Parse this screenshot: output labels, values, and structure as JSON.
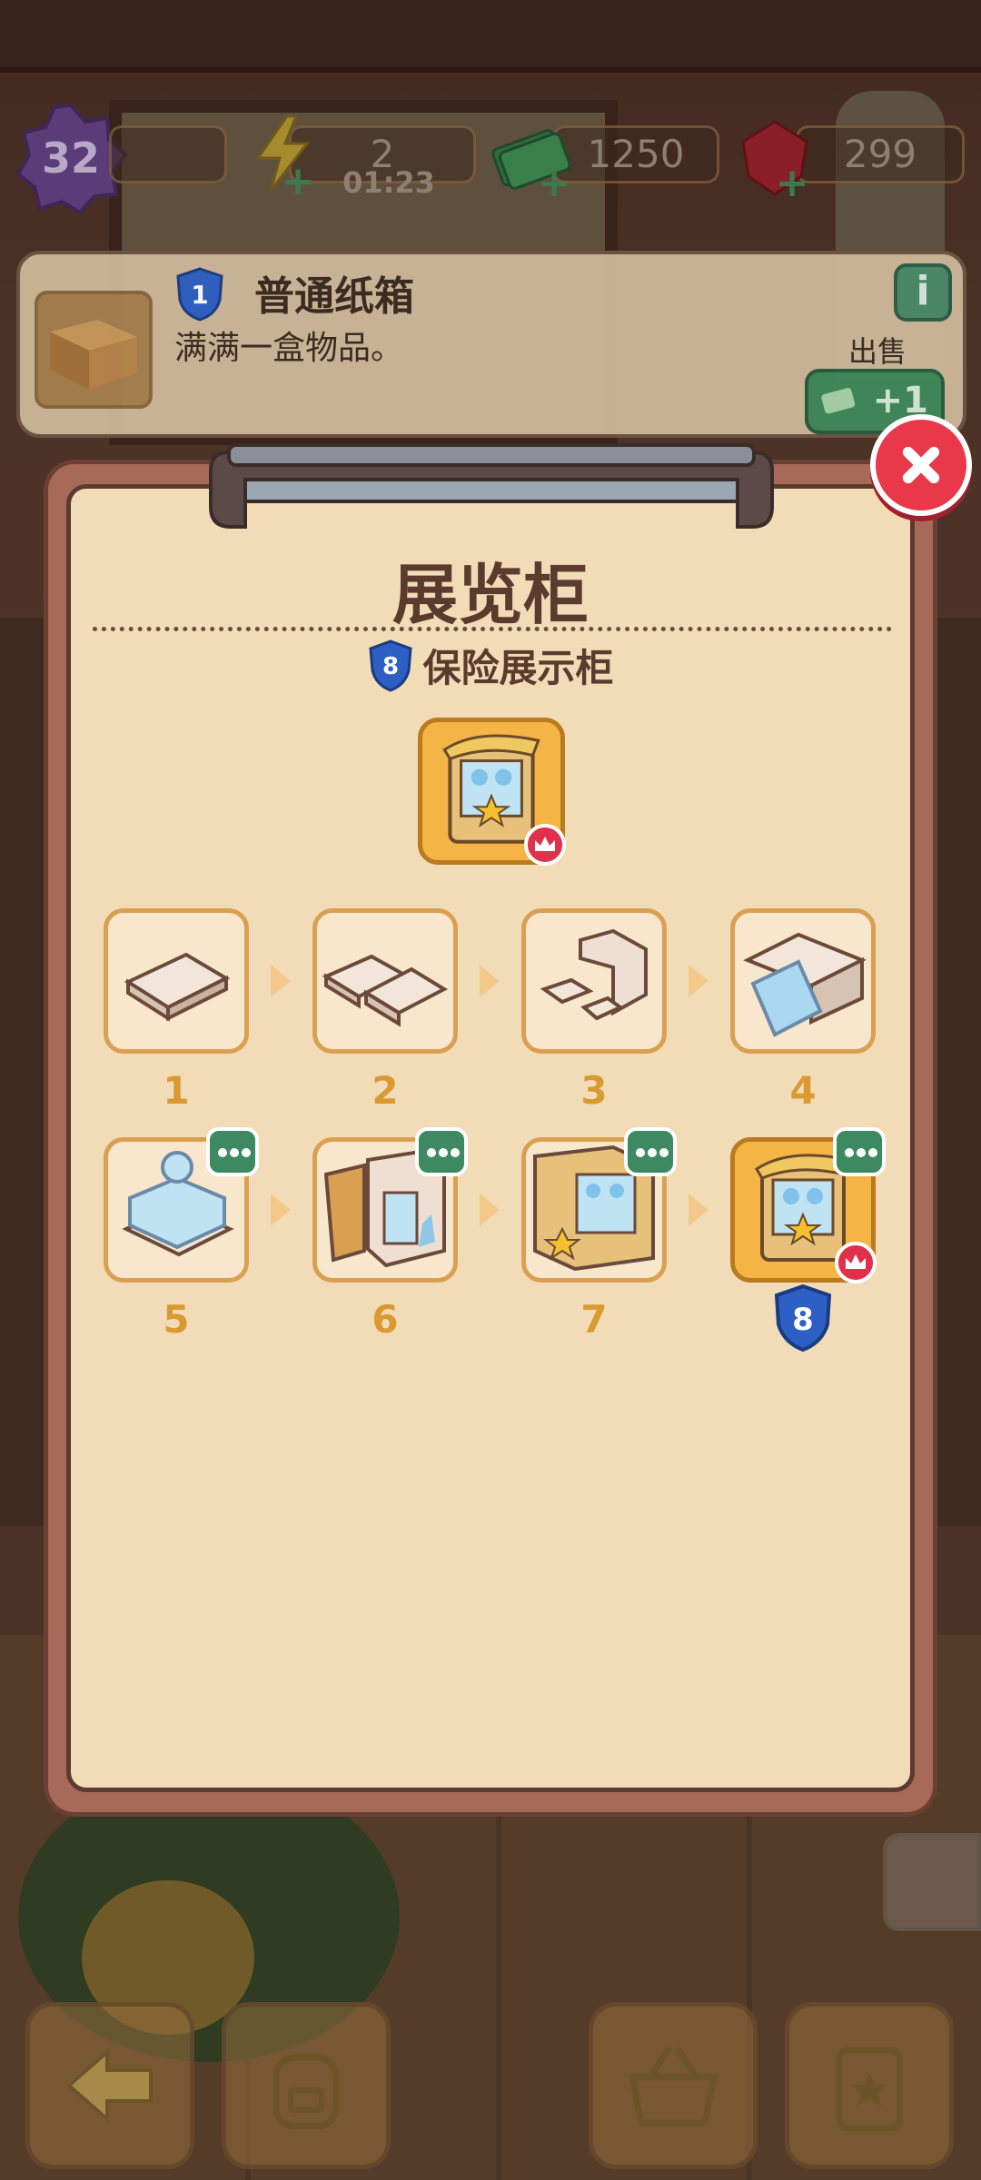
{
  "status_bar": {
    "level": "32",
    "energy": "2",
    "energy_timer": "01:23",
    "cash": "1250",
    "gems": "299"
  },
  "item_info": {
    "level": "1",
    "title": "普通纸箱",
    "description": "满满一盒物品。",
    "sell_label": "出售",
    "sell_value": "+1",
    "info_icon": "i"
  },
  "dialog": {
    "title": "展览柜",
    "subtitle_level": "8",
    "subtitle": "保险展示柜",
    "chain": [
      {
        "label": "1",
        "icon": "wood-plank-icon"
      },
      {
        "label": "2",
        "icon": "two-planks-icon"
      },
      {
        "label": "3",
        "icon": "wood-frame-icon"
      },
      {
        "label": "4",
        "icon": "glass-table-icon"
      },
      {
        "label": "5",
        "icon": "glass-case-icon"
      },
      {
        "label": "6",
        "icon": "open-cabinet-icon"
      },
      {
        "label": "7",
        "icon": "display-cabinet-icon"
      },
      {
        "label": "8",
        "icon": "safe-display-cabinet-icon"
      }
    ]
  },
  "colors": {
    "dialog_bg": "#f2dcb8",
    "tile_border": "#d9a052",
    "gold_tile": "#f4b446",
    "close_red": "#e8384a",
    "badge_green": "#3d8a62",
    "level_blue": "#2d5fc4"
  }
}
